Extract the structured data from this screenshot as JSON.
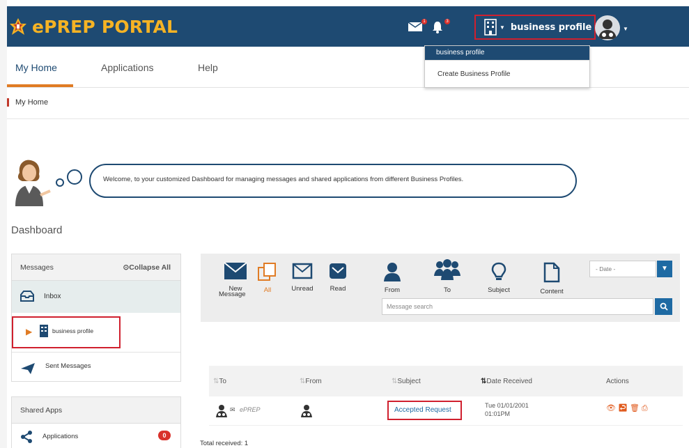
{
  "header": {
    "logo_text": "ePREP PORTAL",
    "profile_label": "business profile",
    "messages_badge": "1",
    "notifications_badge": "3"
  },
  "profile_dropdown": {
    "items": [
      "business profile",
      "Create Business Profile"
    ]
  },
  "nav": {
    "tabs": [
      "My Home",
      "Applications",
      "Help"
    ],
    "active": "My Home"
  },
  "breadcrumb": "My Home",
  "welcome_text": "Welcome, to your customized Dashboard for managing messages and shared applications from different Business Profiles.",
  "dashboard_title": "Dashboard",
  "messages_panel": {
    "title": "Messages",
    "collapse_label": "Collapse All",
    "inbox": "Inbox",
    "business_profile": "business profile",
    "sent": "Sent Messages"
  },
  "shared_apps_panel": {
    "title": "Shared Apps",
    "applications_label": "Applications",
    "applications_count": "0"
  },
  "filters": {
    "new_line1": "New",
    "new_line2": "Message",
    "all": "All",
    "unread": "Unread",
    "read": "Read",
    "from": "From",
    "to": "To",
    "subject": "Subject",
    "content": "Content",
    "date_placeholder": "- Date -",
    "search_placeholder": "Message search"
  },
  "table": {
    "headers": [
      "To",
      "From",
      "Subject",
      "Date Received",
      "Actions"
    ],
    "rows": [
      {
        "to": "ePREP",
        "from": "",
        "subject": "Accepted Request",
        "date_line1": "Tue 01/01/2001",
        "date_line2": "01:01PM"
      }
    ]
  },
  "total_received": "Total received: 1",
  "colors": {
    "header_bg": "#1e4a72",
    "logo_text": "#f5b324",
    "accent_orange": "#e07b24",
    "highlight_red": "#d0202e",
    "button_blue": "#1e6aa3"
  }
}
